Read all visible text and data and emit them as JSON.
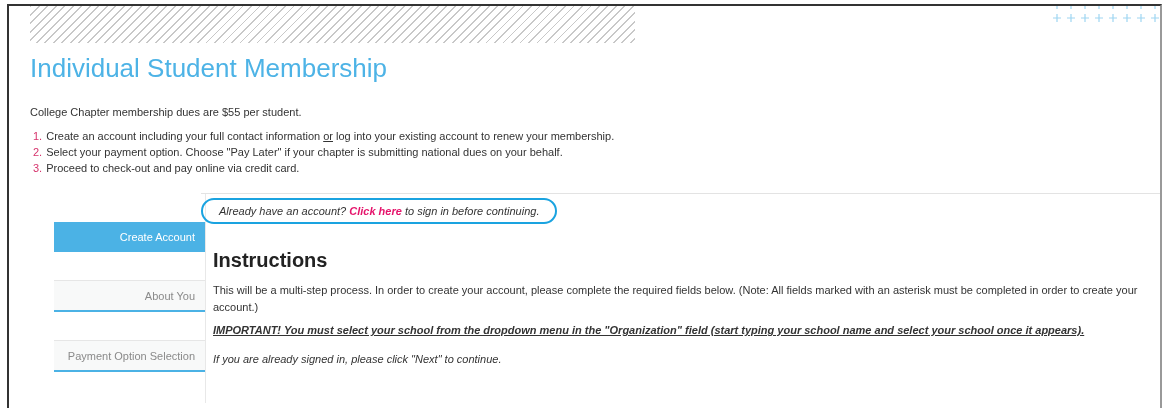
{
  "title": "Individual Student Membership",
  "intro": "College Chapter membership dues are $55 per student.",
  "steps": [
    {
      "number": "1.",
      "parts": [
        {
          "text": "Create an account including your full contact information ",
          "underline": false
        },
        {
          "text": "or",
          "underline": true
        },
        {
          "text": " log into your existing account to renew your membership.",
          "underline": false
        }
      ]
    },
    {
      "number": "2.",
      "parts": [
        {
          "text": "Select your payment option. Choose \"Pay Later\" if your chapter is submitting national dues on your behalf.",
          "underline": false
        }
      ]
    },
    {
      "number": "3.",
      "parts": [
        {
          "text": "Proceed to check-out and pay online via credit card.",
          "underline": false
        }
      ]
    }
  ],
  "signin_prompt": {
    "before": "Already have an account?",
    "link": "Click here",
    "after": "to sign in before continuing.",
    "circled": true
  },
  "sidebar": {
    "items": [
      {
        "label": "Create Account",
        "selected": true
      },
      {
        "label": "About You",
        "selected": false
      },
      {
        "label": "Payment Option Selection",
        "selected": false
      }
    ]
  },
  "heading": "Instructions",
  "paragraphs": [
    {
      "kind": "plain",
      "text": "This will be a multi-step process. In order to create your account, please complete the required fields below. (Note: All fields marked with an asterisk must be completed in order to create your account.)"
    },
    {
      "kind": "important",
      "text": "IMPORTANT! You must select your school from the dropdown menu in the \"Organization\" field (start typing your school name and select your school once it appears)."
    },
    {
      "kind": "note",
      "text": "If you are already signed in, please click \"Next\" to continue."
    }
  ]
}
